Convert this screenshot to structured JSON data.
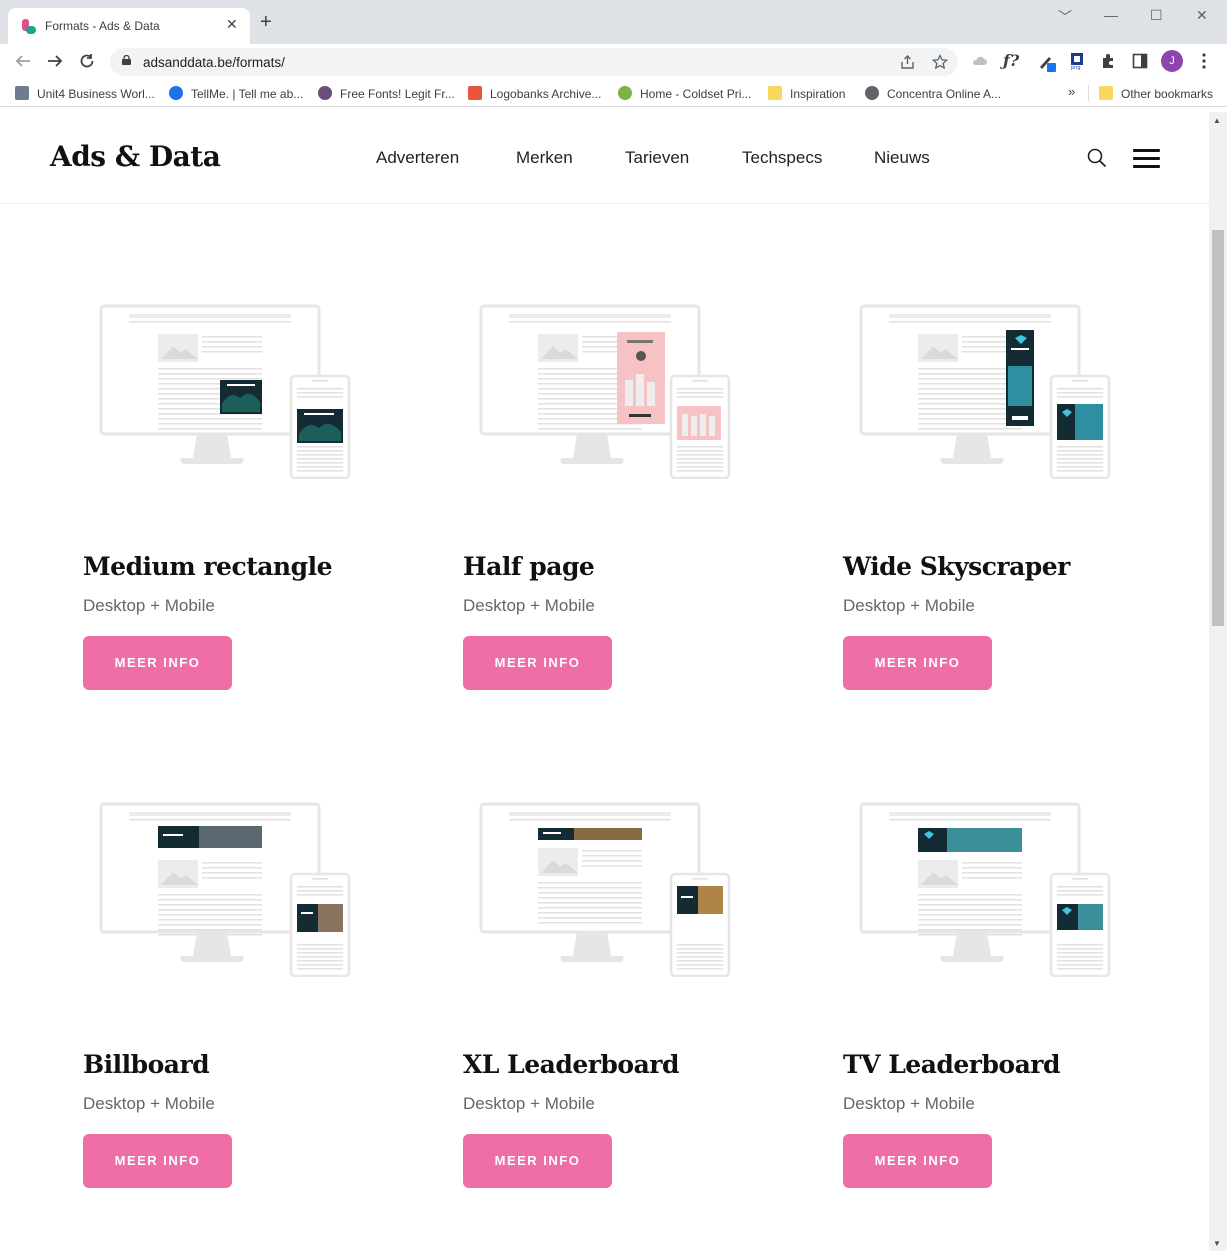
{
  "browser": {
    "tab_title": "Formats - Ads & Data",
    "tab_close": "✕",
    "new_tab": "+",
    "url": "adsanddata.be/formats/",
    "avatar_letter": "J",
    "window_controls": [
      "﹀",
      "—",
      "☐",
      "✕"
    ],
    "bookmarks": [
      {
        "label": "Unit4 Business Worl...",
        "color": "#6b7d8e"
      },
      {
        "label": "TellMe. | Tell me ab...",
        "color": "#1a73e8"
      },
      {
        "label": "Free Fonts! Legit Fr...",
        "color": "#6a4c7d"
      },
      {
        "label": "Logobanks Archive...",
        "color": "#e8553e"
      },
      {
        "label": "Home - Coldset Pri...",
        "color": "#7cb342"
      },
      {
        "label": "Inspiration",
        "color": "#f9d65c"
      },
      {
        "label": "Concentra Online A...",
        "color": "#5f6368"
      }
    ],
    "bookmarks_overflow": "»",
    "other_bookmarks": "Other bookmarks"
  },
  "site": {
    "logo": "Ads & Data",
    "menu": [
      "Adverteren",
      "Merken",
      "Tarieven",
      "Techspecs",
      "Nieuws"
    ],
    "accent": "#f06ea7"
  },
  "formats": [
    {
      "title": "Medium rectangle",
      "subtitle": "Desktop + Mobile",
      "button": "MEER INFO",
      "ad": "rect"
    },
    {
      "title": "Half page",
      "subtitle": "Desktop + Mobile",
      "button": "MEER INFO",
      "ad": "half"
    },
    {
      "title": "Wide Skyscraper",
      "subtitle": "Desktop + Mobile",
      "button": "MEER INFO",
      "ad": "sky"
    },
    {
      "title": "Billboard",
      "subtitle": "Desktop + Mobile",
      "button": "MEER INFO",
      "ad": "billboard"
    },
    {
      "title": "XL Leaderboard",
      "subtitle": "Desktop + Mobile",
      "button": "MEER INFO",
      "ad": "xl"
    },
    {
      "title": "TV Leaderboard",
      "subtitle": "Desktop + Mobile",
      "button": "MEER INFO",
      "ad": "tv"
    }
  ]
}
